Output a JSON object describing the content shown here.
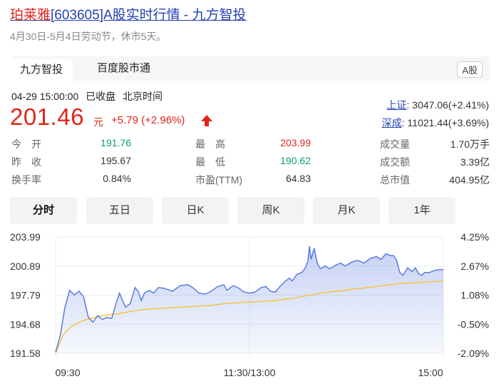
{
  "header": {
    "stock_name": "珀莱雅",
    "title_rest": "[603605]A股实时行情 - 九方智投",
    "holiday_notice": "4月30日-5月4日劳动节，休市5天。"
  },
  "tabs": [
    {
      "label": "九方智投",
      "active": true
    },
    {
      "label": "百度股市通",
      "active": false
    }
  ],
  "market_badge": "A股",
  "quote": {
    "datetime": "04-29 15:00:00",
    "status": "已收盘",
    "timezone": "北京时间",
    "price": "201.46",
    "unit": "元",
    "change": "+5.79 (+2.96%)",
    "direction": "up"
  },
  "indices": [
    {
      "name": "上证",
      "value": ": 3047.06(+2.41%)"
    },
    {
      "name": "深成",
      "value": ": 11021.44(+3.69%)"
    }
  ],
  "stats": [
    [
      {
        "label": "今　开",
        "value": "191.76",
        "color": "green"
      },
      {
        "label": "最　高",
        "value": "203.99",
        "color": "red"
      },
      {
        "label": "成交量",
        "value": "1.70万手",
        "color": "neutral"
      }
    ],
    [
      {
        "label": "昨　收",
        "value": "195.67",
        "color": "neutral"
      },
      {
        "label": "最　低",
        "value": "190.62",
        "color": "green"
      },
      {
        "label": "成交额",
        "value": "3.39亿",
        "color": "neutral"
      }
    ],
    [
      {
        "label": "换手率",
        "value": "0.84%",
        "color": "neutral"
      },
      {
        "label": "市盈(TTM)",
        "value": "64.83",
        "color": "neutral"
      },
      {
        "label": "总市值",
        "value": "404.95亿",
        "color": "neutral"
      }
    ]
  ],
  "period_tabs": [
    {
      "label": "分时",
      "active": true
    },
    {
      "label": "五日",
      "active": false
    },
    {
      "label": "日K",
      "active": false
    },
    {
      "label": "周K",
      "active": false
    },
    {
      "label": "月K",
      "active": false
    },
    {
      "label": "1年",
      "active": false
    }
  ],
  "colors": {
    "up": "#e1251b",
    "down": "#0aa06e",
    "price_line": "#5b7be0",
    "avg_line": "#f5c445",
    "link": "#2440b3"
  },
  "chart_data": {
    "type": "line",
    "title": "",
    "y_ticks_left": [
      "203.99",
      "200.89",
      "197.79",
      "194.68",
      "191.58"
    ],
    "y_ticks_right": [
      "4.25%",
      "2.67%",
      "1.08%",
      "-0.50%",
      "-2.09%"
    ],
    "x_ticks": [
      "09:30",
      "11:30/13:00",
      "15:00"
    ],
    "ylim": [
      191.58,
      203.99
    ],
    "total_minutes": 240,
    "series": [
      {
        "role": "price",
        "points": [
          [
            0,
            191.7
          ],
          [
            3,
            193.5
          ],
          [
            6,
            196.5
          ],
          [
            9,
            198.3
          ],
          [
            12,
            197.8
          ],
          [
            15,
            198.2
          ],
          [
            18,
            197.6
          ],
          [
            21,
            195.4
          ],
          [
            24,
            194.9
          ],
          [
            27,
            195.6
          ],
          [
            30,
            195.2
          ],
          [
            33,
            195.4
          ],
          [
            36,
            195.3
          ],
          [
            39,
            197.0
          ],
          [
            41,
            198.0
          ],
          [
            43,
            197.2
          ],
          [
            45,
            196.5
          ],
          [
            48,
            196.9
          ],
          [
            51,
            198.6
          ],
          [
            53,
            198.2
          ],
          [
            55,
            197.2
          ],
          [
            57,
            198.0
          ],
          [
            60,
            198.3
          ],
          [
            63,
            198.0
          ],
          [
            66,
            198.6
          ],
          [
            70,
            198.5
          ],
          [
            75,
            198.2
          ],
          [
            80,
            198.8
          ],
          [
            85,
            198.9
          ],
          [
            88,
            198.6
          ],
          [
            92,
            198.0
          ],
          [
            96,
            197.9
          ],
          [
            100,
            198.2
          ],
          [
            104,
            198.7
          ],
          [
            108,
            198.9
          ],
          [
            110,
            198.3
          ],
          [
            114,
            198.8
          ],
          [
            118,
            198.5
          ],
          [
            120,
            198.2
          ],
          [
            124,
            198.0
          ],
          [
            128,
            198.1
          ],
          [
            132,
            198.6
          ],
          [
            135,
            198.7
          ],
          [
            138,
            198.2
          ],
          [
            141,
            198.1
          ],
          [
            144,
            198.7
          ],
          [
            147,
            199.2
          ],
          [
            150,
            199.6
          ],
          [
            152,
            199.3
          ],
          [
            155,
            200.0
          ],
          [
            158,
            200.2
          ],
          [
            160,
            200.6
          ],
          [
            162,
            201.4
          ],
          [
            163,
            203.0
          ],
          [
            164,
            201.6
          ],
          [
            166,
            202.8
          ],
          [
            168,
            201.2
          ],
          [
            170,
            200.6
          ],
          [
            173,
            200.9
          ],
          [
            176,
            200.6
          ],
          [
            180,
            201.0
          ],
          [
            183,
            201.2
          ],
          [
            186,
            200.9
          ],
          [
            190,
            201.3
          ],
          [
            194,
            201.5
          ],
          [
            198,
            201.2
          ],
          [
            202,
            201.7
          ],
          [
            206,
            201.9
          ],
          [
            209,
            201.6
          ],
          [
            212,
            202.2
          ],
          [
            215,
            202.0
          ],
          [
            217,
            202.0
          ],
          [
            219,
            201.5
          ],
          [
            221,
            200.2
          ],
          [
            223,
            199.9
          ],
          [
            226,
            200.7
          ],
          [
            229,
            200.3
          ],
          [
            231,
            200.7
          ],
          [
            233,
            200.1
          ],
          [
            235,
            199.9
          ],
          [
            237,
            200.2
          ],
          [
            240,
            200.2
          ],
          [
            243,
            200.4
          ],
          [
            246,
            200.5
          ],
          [
            249,
            200.5
          ]
        ]
      },
      {
        "role": "average",
        "points": [
          [
            0,
            191.6
          ],
          [
            5,
            193.6
          ],
          [
            10,
            194.4
          ],
          [
            15,
            194.9
          ],
          [
            20,
            195.2
          ],
          [
            25,
            195.4
          ],
          [
            30,
            195.6
          ],
          [
            40,
            195.8
          ],
          [
            50,
            196.1
          ],
          [
            60,
            196.3
          ],
          [
            70,
            196.4
          ],
          [
            80,
            196.5
          ],
          [
            90,
            196.6
          ],
          [
            100,
            196.7
          ],
          [
            110,
            196.9
          ],
          [
            120,
            197.0
          ],
          [
            130,
            197.1
          ],
          [
            140,
            197.2
          ],
          [
            150,
            197.4
          ],
          [
            160,
            197.7
          ],
          [
            170,
            198.0
          ],
          [
            180,
            198.2
          ],
          [
            190,
            198.4
          ],
          [
            200,
            198.6
          ],
          [
            210,
            198.8
          ],
          [
            220,
            199.0
          ],
          [
            230,
            199.1
          ],
          [
            240,
            199.2
          ],
          [
            249,
            199.3
          ]
        ]
      }
    ]
  }
}
